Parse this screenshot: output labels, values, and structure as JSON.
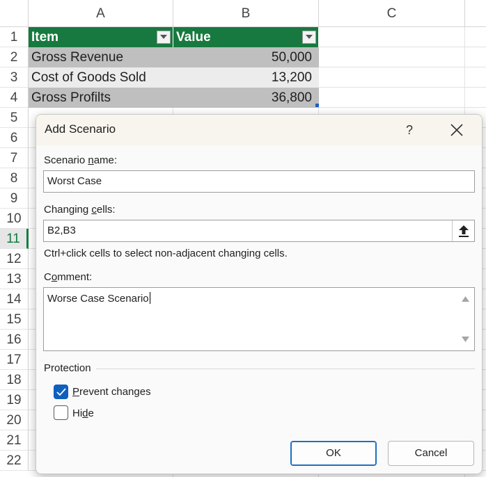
{
  "sheet": {
    "columns": [
      "A",
      "B",
      "C"
    ],
    "rows": [
      "1",
      "2",
      "3",
      "4",
      "5",
      "6",
      "7",
      "8",
      "9",
      "10",
      "11",
      "12",
      "13",
      "14",
      "15",
      "16",
      "17",
      "18",
      "19",
      "20",
      "21",
      "22"
    ],
    "active_row": "11",
    "table": {
      "headers": [
        "Item",
        "Value"
      ],
      "rows": [
        [
          "Gross Revenue",
          "50,000"
        ],
        [
          "Cost of Goods Sold",
          "13,200"
        ],
        [
          "Gross Profilts",
          "36,800"
        ]
      ]
    },
    "colors": {
      "header_green": "#17793f",
      "band_dark": "#bfbfbf",
      "band_light": "#ececec"
    }
  },
  "dialog": {
    "title": "Add Scenario",
    "help_label": "?",
    "scenario_name": {
      "label_before": "Scenario ",
      "label_mnemonic": "n",
      "label_after": "ame:",
      "value": "Worst Case"
    },
    "changing_cells": {
      "label_before": "Changing ",
      "label_mnemonic": "c",
      "label_after": "ells:",
      "value": "B2,B3"
    },
    "hint": "Ctrl+click cells to select non-adjacent changing cells.",
    "comment": {
      "label_before": "C",
      "label_mnemonic": "o",
      "label_after": "mment:",
      "value": "Worse Case Scenario"
    },
    "protection": {
      "heading": "Protection",
      "prevent_changes": {
        "label_before": "",
        "label_mnemonic": "P",
        "label_after": "revent changes",
        "checked": true
      },
      "hide": {
        "label_before": "Hi",
        "label_mnemonic": "d",
        "label_after": "e",
        "checked": false
      }
    },
    "ok_label": "OK",
    "cancel_label": "Cancel",
    "accent_color": "#0f5fbf"
  }
}
